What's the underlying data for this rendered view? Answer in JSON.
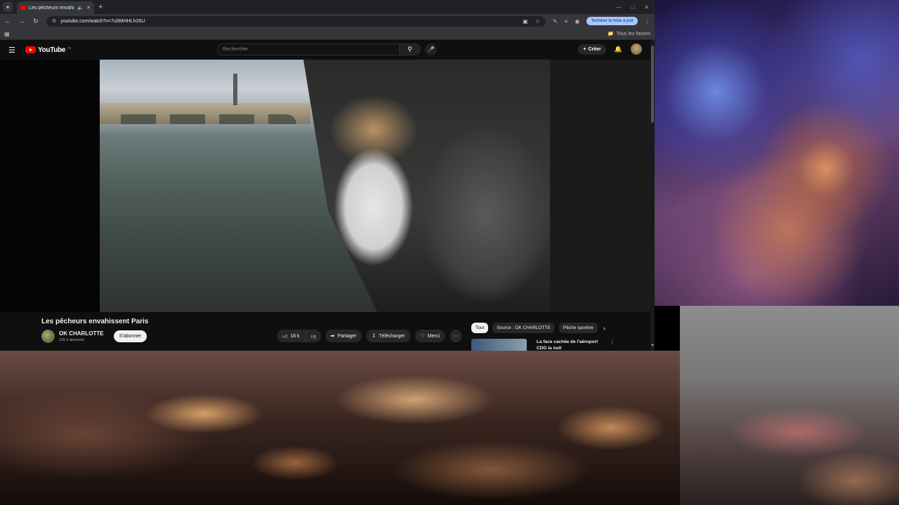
{
  "browser": {
    "tab_title": "Les pêcheurs envahissent P",
    "url": "youtube.com/watch?v=7u5MHHLh26U",
    "update_button": "Terminer la mise à jour",
    "bookmarks_folder": "Tous les favoris"
  },
  "youtube": {
    "logo_text": "YouTube",
    "logo_region": "FR",
    "search_placeholder": "Rechercher",
    "create_label": "Créer",
    "video_title": "Les pêcheurs envahissent Paris",
    "channel_name": "OK CHARLOTTE",
    "subscriber_count": "155 k abonnés",
    "subscribe_label": "S'abonner",
    "like_count": "16 k",
    "share_label": "Partager",
    "download_label": "Télécharger",
    "thanks_label": "Merci",
    "chips": [
      "Tout",
      "Source : OK CHARLOTTE",
      "Pêche sportive"
    ],
    "recommendation_title": "La face cachée de l'aéroport CDG la nuit"
  },
  "colors": {
    "youtube_red": "#ff0000",
    "background": "#0f0f0f",
    "update_button_bg": "#a8c7fa"
  }
}
